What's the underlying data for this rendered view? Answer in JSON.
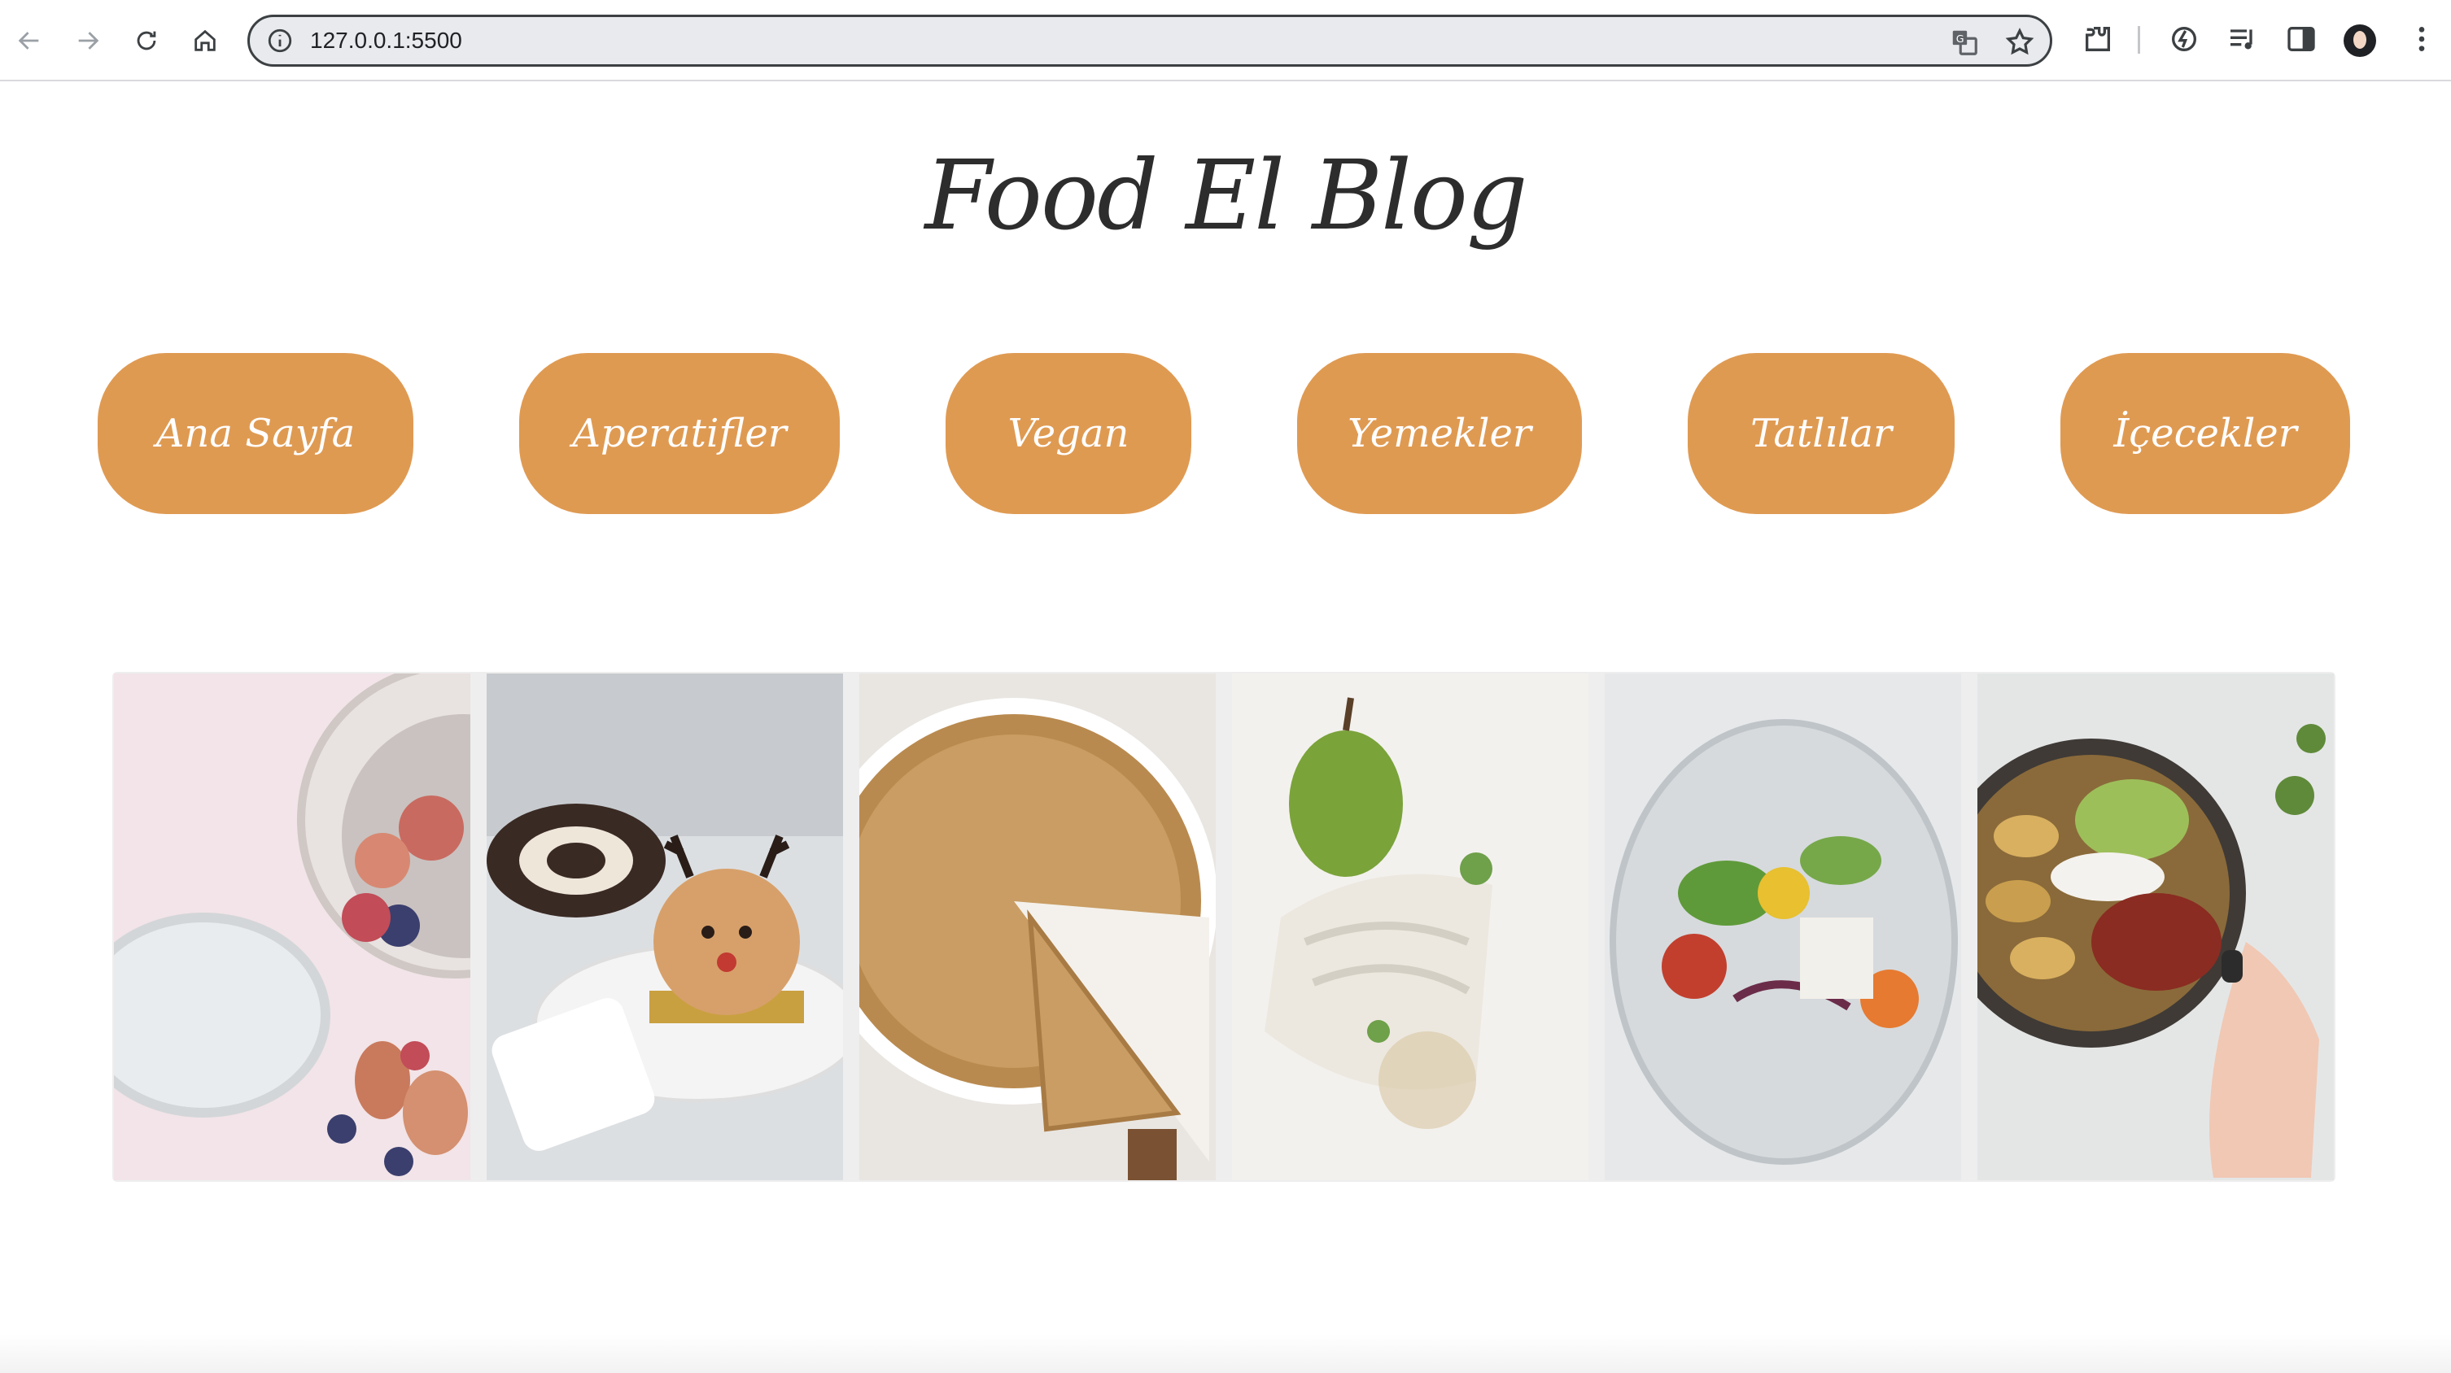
{
  "browser": {
    "url": "127.0.0.1:5500"
  },
  "site": {
    "title": "Food El Blog"
  },
  "menu": [
    {
      "label": "Ana Sayfa"
    },
    {
      "label": "Aperatifler"
    },
    {
      "label": "Vegan"
    },
    {
      "label": "Yemekler"
    },
    {
      "label": "Tatlılar"
    },
    {
      "label": "İçecekler"
    }
  ],
  "gallery": {
    "photos": [
      {
        "subject": "chia pudding with figs and blueberries"
      },
      {
        "subject": "reindeer dessert and chocolate roll cake"
      },
      {
        "subject": "pie with a slice cut out"
      },
      {
        "subject": "pear and plated vegetable dish"
      },
      {
        "subject": "salad in a glass with microgreens"
      },
      {
        "subject": "bowl with plantains, guacamole and beans"
      }
    ]
  },
  "colors": {
    "menu_button": "#df9a52",
    "title_text": "#2d2d2d",
    "page_bg": "#ffffff"
  }
}
